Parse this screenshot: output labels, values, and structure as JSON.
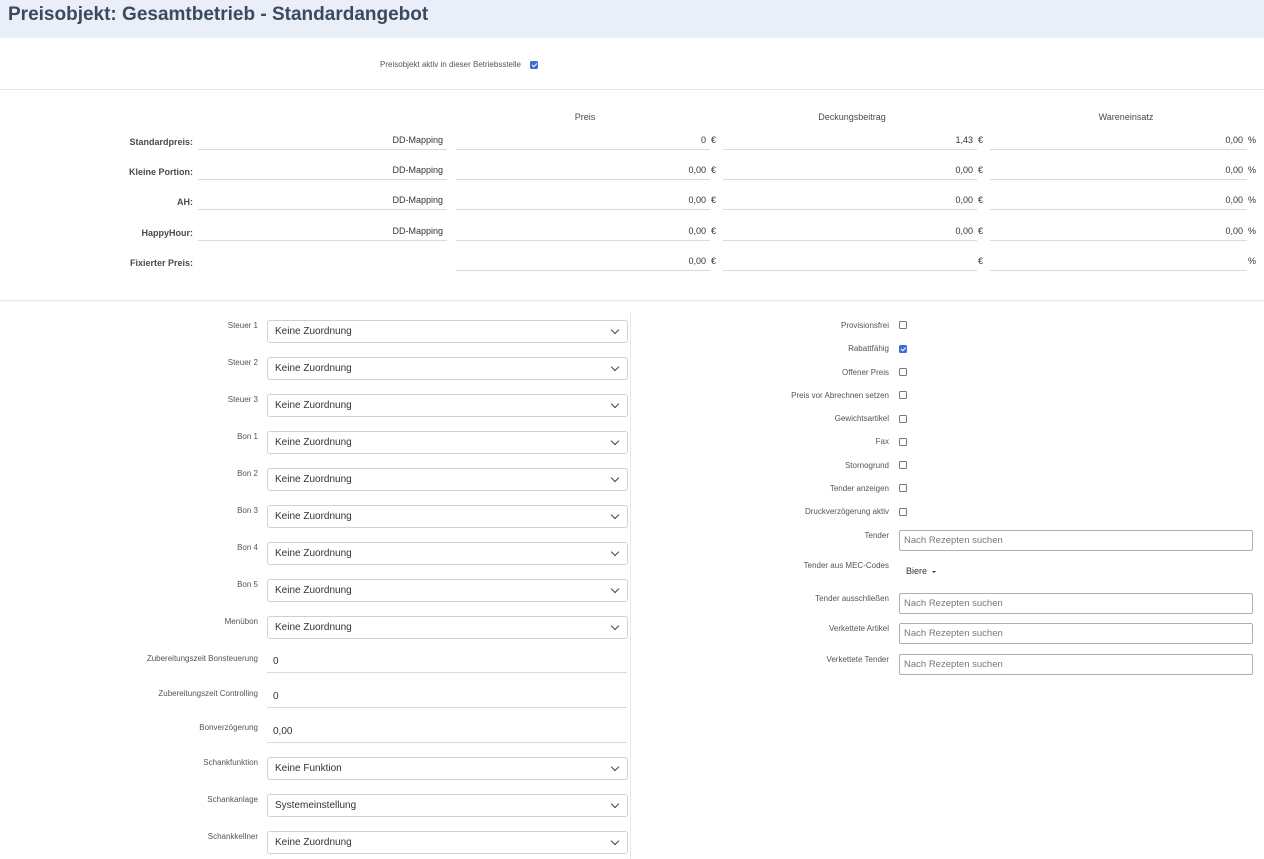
{
  "header": {
    "title": "Preisobjekt: Gesamtbetrieb - Standardangebot"
  },
  "active": {
    "label": "Preisobjekt aktiv in dieser Betriebsstelle",
    "checked": true
  },
  "price_grid": {
    "columns": [
      "Preis",
      "Deckungsbeitrag",
      "Wareneinsatz"
    ],
    "rows": [
      {
        "label": "Standardpreis:",
        "mapping": "DD-Mapping",
        "preis": "0",
        "preis_unit": "€",
        "db": "1,43",
        "db_unit": "€",
        "we": "0,00",
        "we_unit": "%"
      },
      {
        "label": "Kleine Portion:",
        "mapping": "DD-Mapping",
        "preis": "0,00",
        "preis_unit": "€",
        "db": "0,00",
        "db_unit": "€",
        "we": "0,00",
        "we_unit": "%"
      },
      {
        "label": "AH:",
        "mapping": "DD-Mapping",
        "preis": "0,00",
        "preis_unit": "€",
        "db": "0,00",
        "db_unit": "€",
        "we": "0,00",
        "we_unit": "%"
      },
      {
        "label": "HappyHour:",
        "mapping": "DD-Mapping",
        "preis": "0,00",
        "preis_unit": "€",
        "db": "0,00",
        "db_unit": "€",
        "we": "0,00",
        "we_unit": "%"
      },
      {
        "label": "Fixierter Preis:",
        "mapping": "",
        "preis": "0,00",
        "preis_unit": "€",
        "db": "",
        "db_unit": "€",
        "we": "",
        "we_unit": "%"
      }
    ]
  },
  "left_form": {
    "selects": [
      {
        "label": "Steuer 1",
        "value": "Keine Zuordnung"
      },
      {
        "label": "Steuer 2",
        "value": "Keine Zuordnung"
      },
      {
        "label": "Steuer 3",
        "value": "Keine Zuordnung"
      },
      {
        "label": "Bon 1",
        "value": "Keine Zuordnung"
      },
      {
        "label": "Bon 2",
        "value": "Keine Zuordnung"
      },
      {
        "label": "Bon 3",
        "value": "Keine Zuordnung"
      },
      {
        "label": "Bon 4",
        "value": "Keine Zuordnung"
      },
      {
        "label": "Bon 5",
        "value": "Keine Zuordnung"
      },
      {
        "label": "Menübon",
        "value": "Keine Zuordnung"
      }
    ],
    "inputs": [
      {
        "label": "Zubereitungszeit Bonsteuerung",
        "value": "0"
      },
      {
        "label": "Zubereitungszeit Controlling",
        "value": "0"
      },
      {
        "label": "Bonverzögerung",
        "value": "0,00"
      }
    ],
    "selects2": [
      {
        "label": "Schankfunktion",
        "value": "Keine Funktion"
      },
      {
        "label": "Schankanlage",
        "value": "Systemeinstellung"
      },
      {
        "label": "Schankkellner",
        "value": "Keine Zuordnung"
      }
    ]
  },
  "right_form": {
    "checkboxes": [
      {
        "label": "Provisionsfrei",
        "checked": false
      },
      {
        "label": "Rabattfähig",
        "checked": true
      },
      {
        "label": "Offener Preis",
        "checked": false
      },
      {
        "label": "Preis vor Abrechnen setzen",
        "checked": false
      },
      {
        "label": "Gewichtsartikel",
        "checked": false
      },
      {
        "label": "Fax",
        "checked": false
      },
      {
        "label": "Stornogrund",
        "checked": false
      },
      {
        "label": "Tender anzeigen",
        "checked": false
      },
      {
        "label": "Druckverzögerung aktiv",
        "checked": false
      }
    ],
    "tender": {
      "label": "Tender",
      "placeholder": "Nach Rezepten suchen"
    },
    "tender_mec": {
      "label": "Tender aus MEC-Codes",
      "value": "Biere"
    },
    "tender_exclude": {
      "label": "Tender ausschließen",
      "placeholder": "Nach Rezepten suchen"
    },
    "linked_articles": {
      "label": "Verkettete Artikel",
      "placeholder": "Nach Rezepten suchen"
    },
    "linked_tender": {
      "label": "Verkettete Tender",
      "placeholder": "Nach Rezepten suchen"
    }
  }
}
